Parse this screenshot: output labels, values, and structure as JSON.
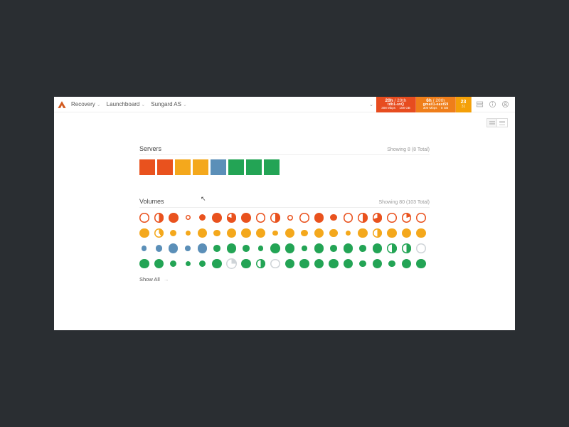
{
  "colors": {
    "red": "#e9521e",
    "amber": "#f4a81c",
    "blue": "#5b8fb8",
    "green": "#23a455",
    "gray": "#cfd4d8"
  },
  "nav": {
    "crumbs": [
      {
        "label": "Recovery"
      },
      {
        "label": "Launchboard"
      },
      {
        "label": "Sungard AS"
      }
    ]
  },
  "metrics": [
    {
      "style": "orange1",
      "top_left": "20h",
      "top_right": "20th",
      "mid": "tdb1-svQ",
      "bot_left": "308 Mbps",
      "bot_right": "108 GB"
    },
    {
      "style": "orange2",
      "top_left": "6h",
      "top_right": "20th",
      "mid": "gmail1-east59",
      "bot_left": "300 Mbps",
      "bot_right": "8 GB"
    }
  ],
  "counter": {
    "value": "23",
    "sub": "31"
  },
  "view_toggle": {
    "active": "card"
  },
  "servers": {
    "title": "Servers",
    "meta": "Showing 8 (8 Total)",
    "items": [
      {
        "c": "red"
      },
      {
        "c": "red"
      },
      {
        "c": "amber"
      },
      {
        "c": "amber"
      },
      {
        "c": "blue"
      },
      {
        "c": "green"
      },
      {
        "c": "green"
      },
      {
        "c": "green"
      }
    ]
  },
  "volumes": {
    "title": "Volumes",
    "meta": "Showing 80 (103 Total)",
    "show_all": "Show All",
    "items": [
      {
        "c": "red",
        "fill": 0,
        "sz": 1
      },
      {
        "c": "red",
        "fill": 0.5,
        "sz": 1
      },
      {
        "c": "red",
        "fill": 1,
        "sz": 1
      },
      {
        "c": "red",
        "fill": 0,
        "sz": 0.55
      },
      {
        "c": "red",
        "fill": 1,
        "sz": 0.7
      },
      {
        "c": "red",
        "fill": 1,
        "sz": 1
      },
      {
        "c": "red",
        "fill": 0.8,
        "sz": 1
      },
      {
        "c": "red",
        "fill": 1,
        "sz": 1
      },
      {
        "c": "red",
        "fill": 0,
        "sz": 1
      },
      {
        "c": "red",
        "fill": 0.5,
        "sz": 1
      },
      {
        "c": "red",
        "fill": 0,
        "sz": 0.6
      },
      {
        "c": "red",
        "fill": 0,
        "sz": 1
      },
      {
        "c": "red",
        "fill": 1,
        "sz": 1
      },
      {
        "c": "red",
        "fill": 1,
        "sz": 0.7
      },
      {
        "c": "red",
        "fill": 0,
        "sz": 1
      },
      {
        "c": "red",
        "fill": 0.5,
        "sz": 1
      },
      {
        "c": "red",
        "fill": 0.7,
        "sz": 1
      },
      {
        "c": "red",
        "fill": 0,
        "sz": 1
      },
      {
        "c": "red",
        "fill": 0.2,
        "sz": 1
      },
      {
        "c": "red",
        "fill": 0,
        "sz": 1
      },
      {
        "c": "amber",
        "fill": 1,
        "sz": 1
      },
      {
        "c": "amber",
        "fill": 0.4,
        "sz": 1
      },
      {
        "c": "amber",
        "fill": 1,
        "sz": 0.7
      },
      {
        "c": "amber",
        "fill": 1,
        "sz": 0.55
      },
      {
        "c": "amber",
        "fill": 1,
        "sz": 1
      },
      {
        "c": "amber",
        "fill": 1,
        "sz": 0.7
      },
      {
        "c": "amber",
        "fill": 1,
        "sz": 1
      },
      {
        "c": "amber",
        "fill": 1,
        "sz": 1
      },
      {
        "c": "amber",
        "fill": 1,
        "sz": 1
      },
      {
        "c": "amber",
        "fill": 1,
        "sz": 0.55
      },
      {
        "c": "amber",
        "fill": 1,
        "sz": 1
      },
      {
        "c": "amber",
        "fill": 1,
        "sz": 0.7
      },
      {
        "c": "amber",
        "fill": 1,
        "sz": 1
      },
      {
        "c": "amber",
        "fill": 1,
        "sz": 0.85
      },
      {
        "c": "amber",
        "fill": 1,
        "sz": 0.55
      },
      {
        "c": "amber",
        "fill": 1,
        "sz": 1
      },
      {
        "c": "amber",
        "fill": 0.5,
        "sz": 1
      },
      {
        "c": "amber",
        "fill": 1,
        "sz": 1
      },
      {
        "c": "amber",
        "fill": 1,
        "sz": 1
      },
      {
        "c": "amber",
        "fill": 1,
        "sz": 1
      },
      {
        "c": "blue",
        "fill": 1,
        "sz": 0.55
      },
      {
        "c": "blue",
        "fill": 1,
        "sz": 0.7
      },
      {
        "c": "blue",
        "fill": 1,
        "sz": 1
      },
      {
        "c": "blue",
        "fill": 1,
        "sz": 0.55
      },
      {
        "c": "blue",
        "fill": 1,
        "sz": 1
      },
      {
        "c": "green",
        "fill": 1,
        "sz": 0.7
      },
      {
        "c": "green",
        "fill": 1,
        "sz": 1
      },
      {
        "c": "green",
        "fill": 1,
        "sz": 0.7
      },
      {
        "c": "green",
        "fill": 1,
        "sz": 0.55
      },
      {
        "c": "green",
        "fill": 1,
        "sz": 1
      },
      {
        "c": "green",
        "fill": 1,
        "sz": 1
      },
      {
        "c": "green",
        "fill": 1,
        "sz": 0.55
      },
      {
        "c": "green",
        "fill": 1,
        "sz": 1
      },
      {
        "c": "green",
        "fill": 1,
        "sz": 0.7
      },
      {
        "c": "green",
        "fill": 1,
        "sz": 1
      },
      {
        "c": "green",
        "fill": 1,
        "sz": 0.7
      },
      {
        "c": "green",
        "fill": 1,
        "sz": 1
      },
      {
        "c": "green",
        "fill": 0.5,
        "sz": 1
      },
      {
        "c": "green",
        "fill": 0.5,
        "sz": 1
      },
      {
        "c": "gray",
        "fill": 0,
        "sz": 1
      },
      {
        "c": "green",
        "fill": 1,
        "sz": 1
      },
      {
        "c": "green",
        "fill": 1,
        "sz": 1
      },
      {
        "c": "green",
        "fill": 1,
        "sz": 0.7
      },
      {
        "c": "green",
        "fill": 1,
        "sz": 0.55
      },
      {
        "c": "green",
        "fill": 1,
        "sz": 0.7
      },
      {
        "c": "green",
        "fill": 1,
        "sz": 1
      },
      {
        "c": "gray",
        "fill": 0.25,
        "sz": 1.15
      },
      {
        "c": "green",
        "fill": 1,
        "sz": 1
      },
      {
        "c": "green",
        "fill": 0.5,
        "sz": 1
      },
      {
        "c": "gray",
        "fill": 0,
        "sz": 1
      },
      {
        "c": "green",
        "fill": 1,
        "sz": 1
      },
      {
        "c": "green",
        "fill": 1,
        "sz": 1
      },
      {
        "c": "green",
        "fill": 1,
        "sz": 1
      },
      {
        "c": "green",
        "fill": 1,
        "sz": 1
      },
      {
        "c": "green",
        "fill": 1,
        "sz": 1
      },
      {
        "c": "green",
        "fill": 1,
        "sz": 0.7
      },
      {
        "c": "green",
        "fill": 1,
        "sz": 1
      },
      {
        "c": "green",
        "fill": 1,
        "sz": 0.7
      },
      {
        "c": "green",
        "fill": 1,
        "sz": 1
      },
      {
        "c": "green",
        "fill": 1,
        "sz": 1
      }
    ]
  }
}
